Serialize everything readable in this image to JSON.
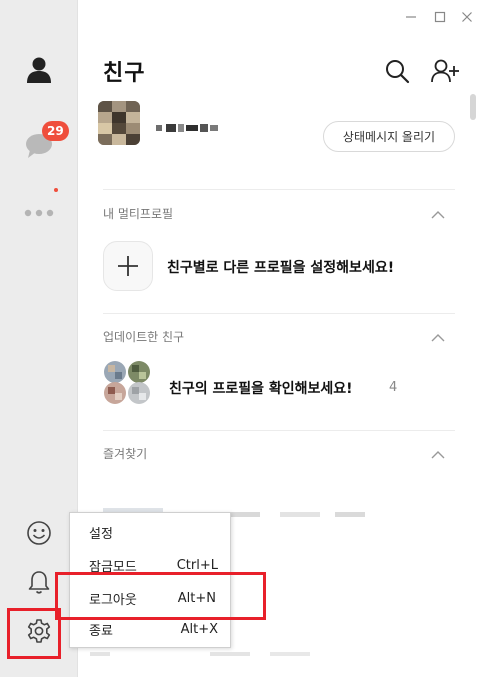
{
  "window": {
    "minimize_glyph": "—",
    "maximize_glyph": "☐",
    "close_glyph": "✕"
  },
  "sidebar": {
    "items": [
      {
        "name": "friends",
        "icon": "person-icon"
      },
      {
        "name": "chats",
        "icon": "chat-bubble-icon",
        "badge": "29"
      },
      {
        "name": "more",
        "icon": "more-dots-icon"
      },
      {
        "name": "emoticon",
        "icon": "smiley-icon"
      },
      {
        "name": "notifications",
        "icon": "bell-icon"
      },
      {
        "name": "settings",
        "icon": "gear-icon"
      }
    ]
  },
  "header": {
    "title": "친구"
  },
  "profile": {
    "status_button": "상태메시지 올리기"
  },
  "sections": {
    "multi_profile": {
      "title": "내 멀티프로필",
      "prompt": "친구별로 다른 프로필을 설정해보세요!"
    },
    "updated": {
      "title": "업데이트한 친구",
      "prompt": "친구의 프로필을 확인해보세요!",
      "count": "4"
    },
    "favorites": {
      "title": "즐겨찾기"
    }
  },
  "menu": {
    "items": [
      {
        "label": "설정",
        "shortcut": ""
      },
      {
        "label": "잠금모드",
        "shortcut": "Ctrl+L"
      },
      {
        "label": "로그아웃",
        "shortcut": "Alt+N"
      },
      {
        "label": "종료",
        "shortcut": "Alt+X"
      }
    ]
  },
  "colors": {
    "badge": "#ef4e3c",
    "highlight": "#e8202a",
    "sidebar_bg": "#ececec"
  }
}
